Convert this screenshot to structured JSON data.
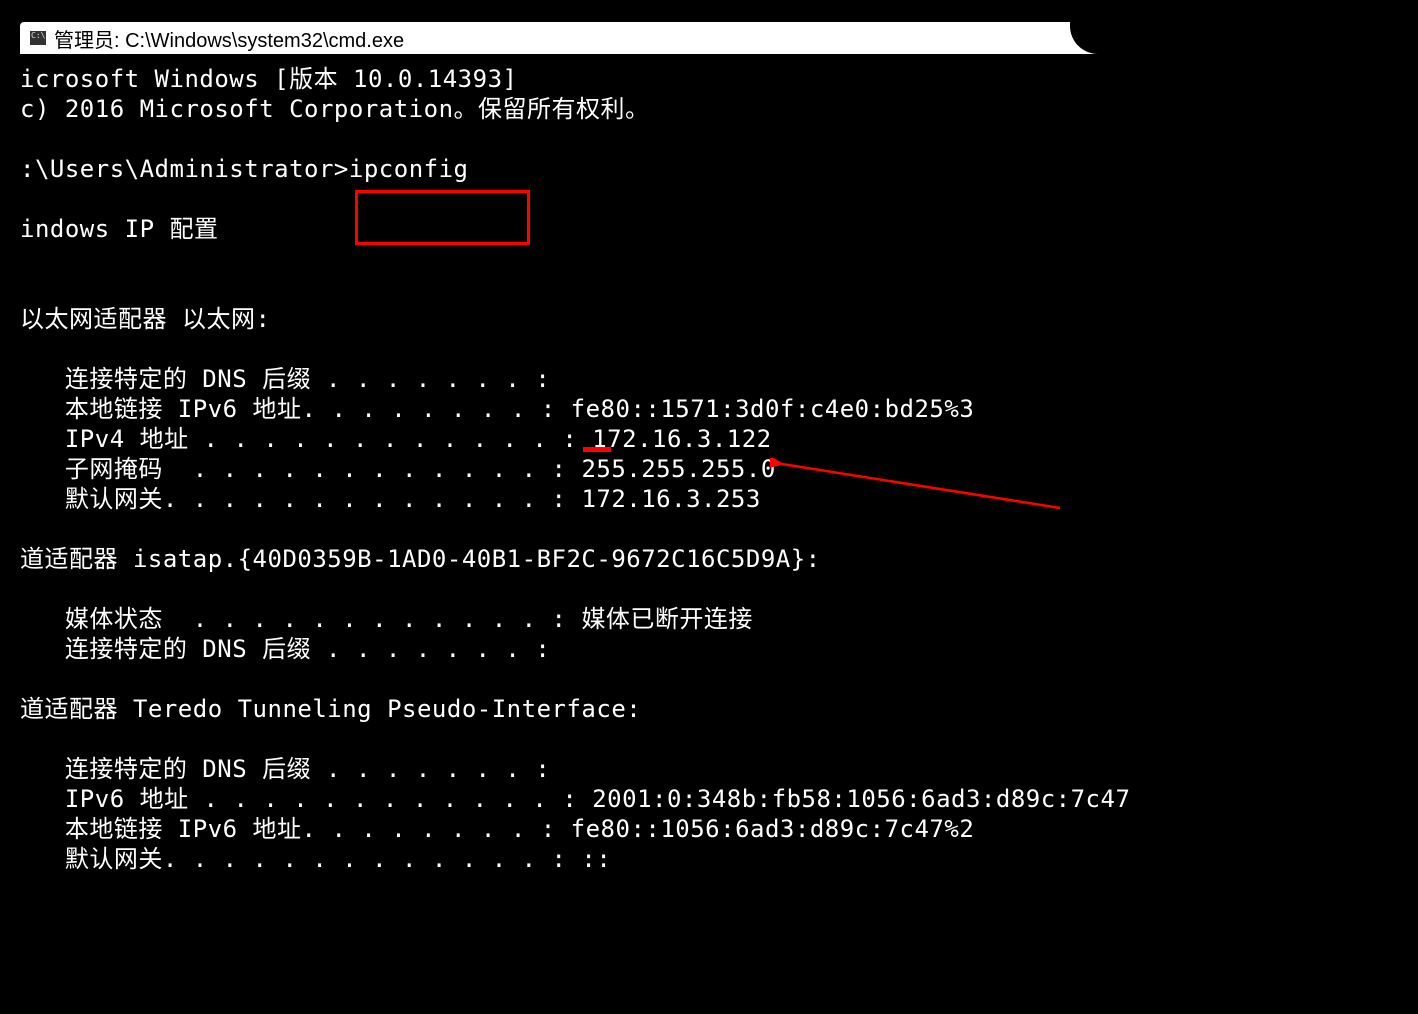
{
  "titlebar": {
    "label": "管理员: C:\\Windows\\system32\\cmd.exe"
  },
  "terminal": {
    "line_ms_version": "icrosoft Windows [版本 10.0.14393]",
    "line_copyright": "c) 2016 Microsoft Corporation。保留所有权利。",
    "prompt_path": ":\\Users\\Administrator>",
    "prompt_command": "ipconfig",
    "ipconfig_header": "indows IP 配置",
    "adapter_eth_header": "以太网适配器 以太网:",
    "eth_dns_suffix_label": "   连接特定的 DNS 后缀 . . . . . . . :",
    "eth_ipv6_ll_label": "   本地链接 IPv6 地址. . . . . . . . : ",
    "eth_ipv6_ll_value": "fe80::1571:3d0f:c4e0:bd25%3",
    "eth_ipv4_label": "   IPv4 地址 . . . . . . . . . . . . : ",
    "eth_ipv4_value": "172.16.3.122",
    "eth_subnet_label": "   子网掩码  . . . . . . . . . . . . : ",
    "eth_subnet_value": "255.255.255.0",
    "eth_gateway_label": "   默认网关. . . . . . . . . . . . . : ",
    "eth_gateway_value": "172.16.3.253",
    "adapter_isatap_header": "道适配器 isatap.{40D0359B-1AD0-40B1-BF2C-9672C16C5D9A}:",
    "isatap_media_label": "   媒体状态  . . . . . . . . . . . . : ",
    "isatap_media_value": "媒体已断开连接",
    "isatap_dns_label": "   连接特定的 DNS 后缀 . . . . . . . :",
    "adapter_teredo_header": "道适配器 Teredo Tunneling Pseudo-Interface:",
    "teredo_dns_label": "   连接特定的 DNS 后缀 . . . . . . . :",
    "teredo_ipv6_label": "   IPv6 地址 . . . . . . . . . . . . : ",
    "teredo_ipv6_value": "2001:0:348b:fb58:1056:6ad3:d89c:7c47",
    "teredo_ipv6_ll_label": "   本地链接 IPv6 地址. . . . . . . . : ",
    "teredo_ipv6_ll_value": "fe80::1056:6ad3:d89c:7c47%2",
    "teredo_gateway_label": "   默认网关. . . . . . . . . . . . . : ::"
  },
  "annotations": {
    "highlight_color": "#ff0000"
  }
}
